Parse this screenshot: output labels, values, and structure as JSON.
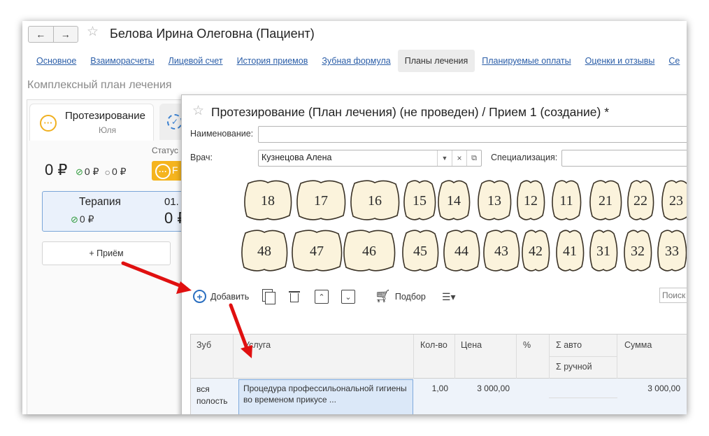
{
  "window": {
    "title": "Белова Ирина Олеговна (Пациент)",
    "back_glyph": "←",
    "forward_glyph": "→"
  },
  "tabs": [
    {
      "label": "Основное"
    },
    {
      "label": "Взаиморасчеты"
    },
    {
      "label": "Лицевой счет"
    },
    {
      "label": "История приемов"
    },
    {
      "label": "Зубная формула"
    },
    {
      "label": "Планы лечения",
      "active": true
    },
    {
      "label": "Планируемые оплаты"
    },
    {
      "label": "Оценки и отзывы"
    },
    {
      "label": "Се"
    }
  ],
  "section_title": "Комплексный план лечения",
  "plan_card": {
    "name": "Протезирование",
    "doctor": "Юля",
    "status_label": "Статус",
    "total": "0 ₽",
    "paid": "0 ₽",
    "pending": "0 ₽",
    "status_btn_text": "F"
  },
  "therapy_card": {
    "name": "Терапия",
    "date": "01.",
    "paid": "0 ₽",
    "total": "0 ₽"
  },
  "add_visit_label": "+ Приём",
  "dialog": {
    "title": "Протезирование (План лечения) (не проведен) / Прием 1 (создание) *",
    "name_label": "Наименование:",
    "name_value": "",
    "doctor_label": "Врач:",
    "doctor_value": "Кузнецова Алена",
    "spec_label": "Специализация:",
    "spec_value": ""
  },
  "teeth": {
    "upper": [
      "18",
      "17",
      "16",
      "15",
      "14",
      "13",
      "12",
      "11",
      "21",
      "22",
      "23"
    ],
    "lower": [
      "48",
      "47",
      "46",
      "45",
      "44",
      "43",
      "42",
      "41",
      "31",
      "32",
      "33"
    ]
  },
  "toolbar": {
    "add_label": "Добавить",
    "pick_label": "Подбор",
    "search_placeholder": "Поиск"
  },
  "table": {
    "headers": {
      "tooth": "Зуб",
      "service": "Услуга",
      "qty": "Кол-во",
      "price": "Цена",
      "percent": "%",
      "auto": "Σ авто",
      "manual": "Σ ручной",
      "sum": "Сумма"
    },
    "rows": [
      {
        "tooth": "вся полость",
        "service": "Процедура профессильональной гигиены во временом прикусе ...",
        "qty": "1,00",
        "price": "3 000,00",
        "percent": "",
        "auto": "",
        "manual": "",
        "sum": "3 000,00"
      }
    ]
  },
  "colors": {
    "link": "#2b5ea8",
    "accent_orange": "#f5b41e",
    "selection": "#dce9f8",
    "arrow": "#e01010"
  }
}
